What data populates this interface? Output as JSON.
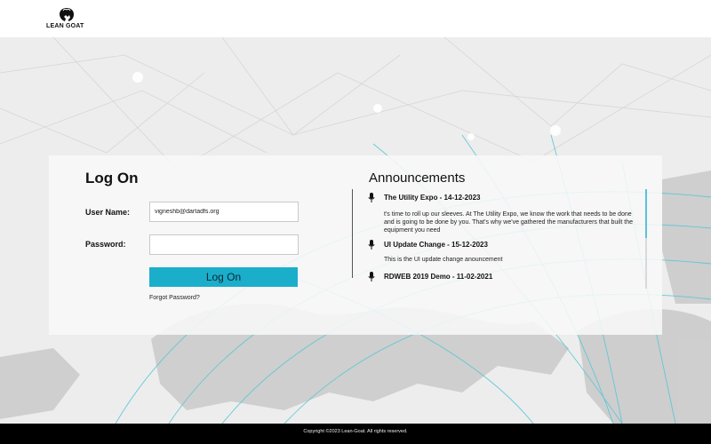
{
  "header": {
    "logo_text": "LEAN GOAT",
    "logo_icon": "goat-logo-icon"
  },
  "login": {
    "title": "Log On",
    "username_label": "User Name:",
    "username_value": "vigneshb@dartadfs.org",
    "password_label": "Password:",
    "password_value": "",
    "button_label": "Log On",
    "forgot_link": "Forgot Password?",
    "button_color": "#1aaecb"
  },
  "announcements": {
    "title": "Announcements",
    "items": [
      {
        "icon": "microphone-icon",
        "title": "The Utility Expo - 14-12-2023",
        "body": "t's time to roll up our sleeves. At The Utility Expo, we know the work that needs to be done and is going to be done by you. That's why we've gathered the manufacturers that built the equipment you need"
      },
      {
        "icon": "microphone-icon",
        "title": "UI Update Change - 15-12-2023",
        "body": "This is the UI update change anouncement"
      },
      {
        "icon": "microphone-icon",
        "title": "RDWEB 2019 Demo - 11-02-2021",
        "body": ""
      }
    ]
  },
  "footer": {
    "copyright": "Copyright ©2023 Lean-Goat. All rights reserved."
  }
}
